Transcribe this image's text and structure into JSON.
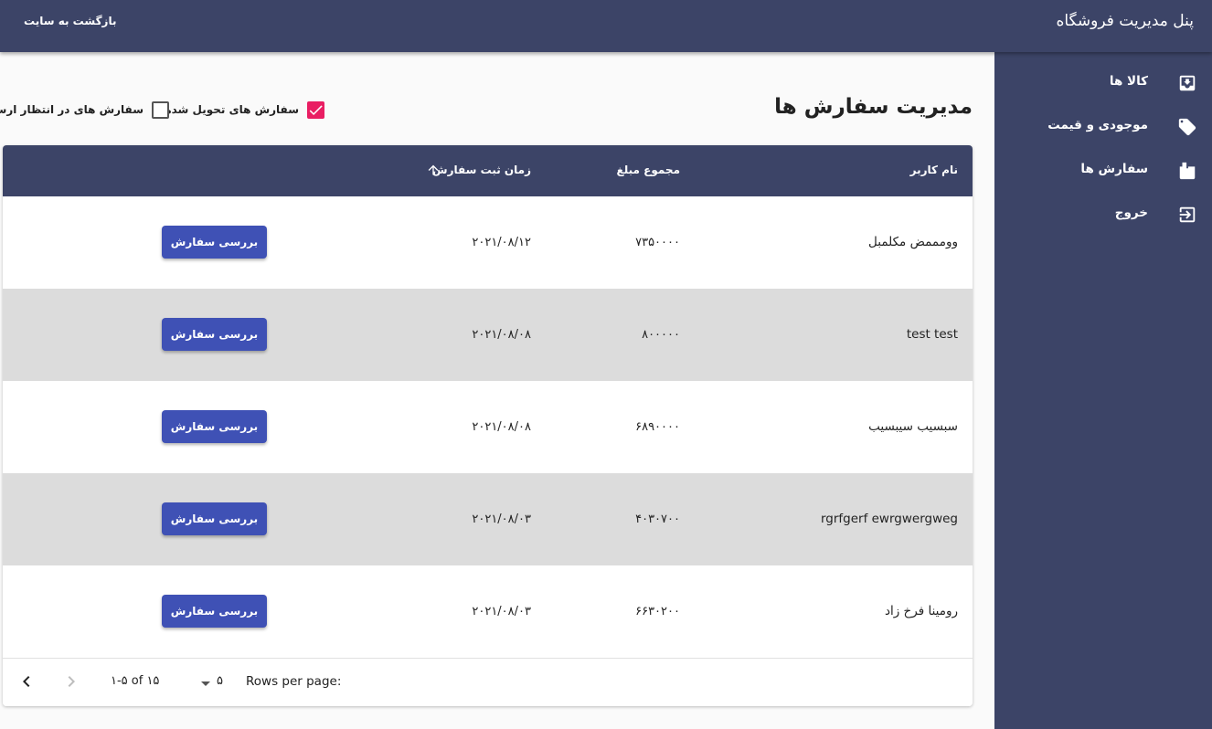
{
  "header": {
    "brand": "پنل مدیریت فروشگاه",
    "back_link": "بازگشت به سایت"
  },
  "sidebar": {
    "items": [
      {
        "label": "کالا ها",
        "icon": "inbox-download-icon"
      },
      {
        "label": "موجودی و قیمت",
        "icon": "price-tag-icon"
      },
      {
        "label": "سفارش ها",
        "icon": "orders-icon"
      },
      {
        "label": "خروج",
        "icon": "logout-icon"
      }
    ]
  },
  "page": {
    "title": "مدیریت سفارش ها"
  },
  "filters": {
    "delivered": {
      "label": "سفارش های تحویل شده",
      "checked": true
    },
    "pending": {
      "label": "سفارش های در انتظار ارسال",
      "checked": false
    }
  },
  "table": {
    "columns": {
      "user": "نام کاربر",
      "total": "مجموع مبلغ",
      "date": "زمان ثبت سفارش"
    },
    "sort": {
      "column": "date",
      "direction": "ascending",
      "icon": "arrow-up-icon"
    },
    "rows": [
      {
        "user": "وومممض مکلمبل",
        "total": "۷۳۵۰۰۰۰",
        "date": "۲۰۲۱/۰۸/۱۲",
        "action": "بررسی سفارش"
      },
      {
        "user": "test test",
        "total": "۸۰۰۰۰۰",
        "date": "۲۰۲۱/۰۸/۰۸",
        "action": "بررسی سفارش"
      },
      {
        "user": "سبسیب سیبسیب",
        "total": "۶۸۹۰۰۰۰",
        "date": "۲۰۲۱/۰۸/۰۸",
        "action": "بررسی سفارش"
      },
      {
        "user": "rgrfgerf ewrgwergweg",
        "total": "۴۰۳۰۷۰۰",
        "date": "۲۰۲۱/۰۸/۰۳",
        "action": "بررسی سفارش"
      },
      {
        "user": "رومینا فرخ زاد",
        "total": "۶۶۳۰۲۰۰",
        "date": "۲۰۲۱/۰۸/۰۳",
        "action": "بررسی سفارش"
      }
    ]
  },
  "pagination": {
    "rows_per_page_label": "Rows per page:",
    "rows_per_page_value": "۵",
    "range": "۱-۵ of ۱۵",
    "prev_icon": "chevron-right-icon",
    "next_icon": "chevron-left-icon"
  },
  "colors": {
    "primary": "#3c4467",
    "button": "#3f51b5",
    "checkbox_checked": "#e91e63",
    "row_alt": "#dcdcdc"
  }
}
